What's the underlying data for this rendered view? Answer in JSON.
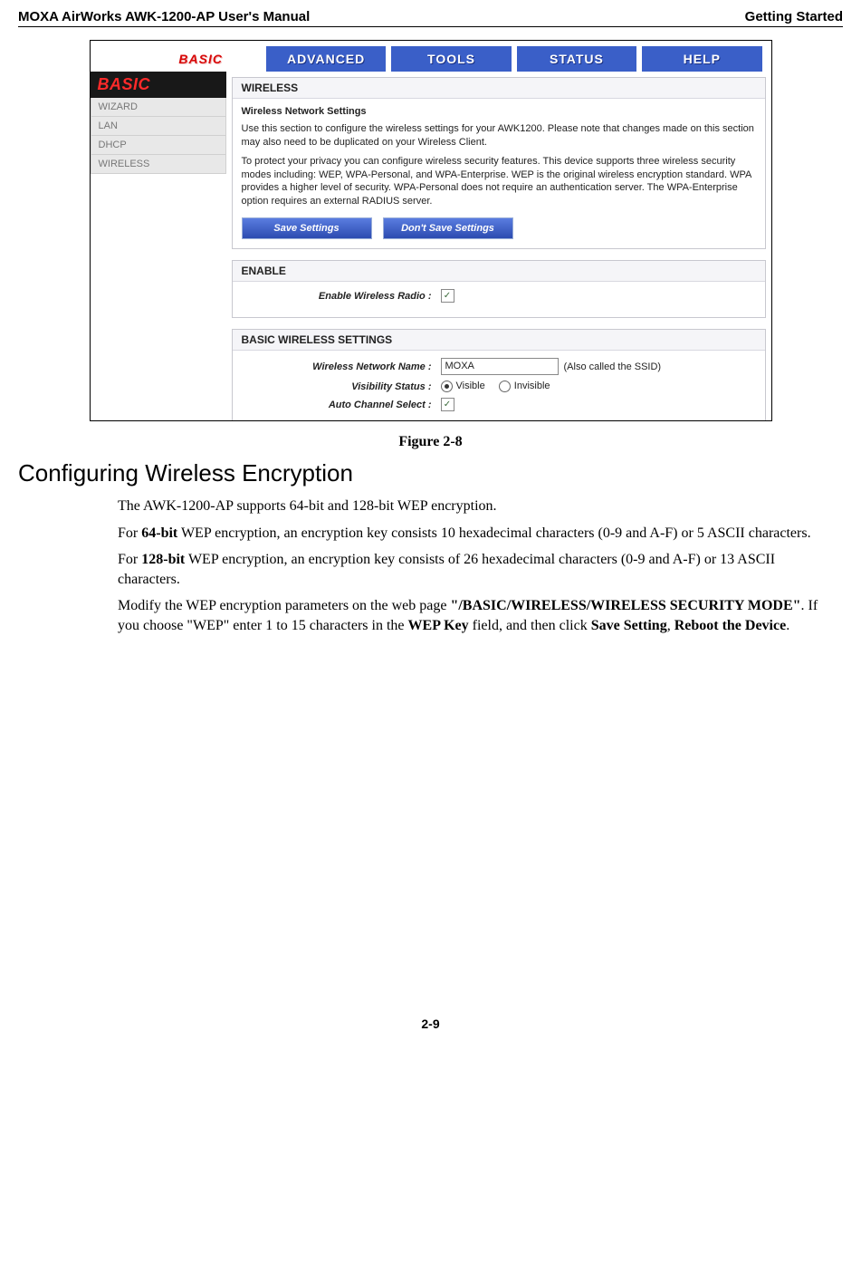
{
  "header": {
    "left": "MOXA AirWorks AWK-1200-AP User's Manual",
    "right": "Getting Started"
  },
  "tabs": {
    "items": [
      "BASIC",
      "ADVANCED",
      "TOOLS",
      "STATUS",
      "HELP"
    ],
    "active_index": 0
  },
  "sidebar": {
    "title": "BASIC",
    "items": [
      "WIZARD",
      "LAN",
      "DHCP",
      "WIRELESS"
    ]
  },
  "panels": {
    "wireless": {
      "title": "WIRELESS",
      "sub_title": "Wireless Network Settings",
      "p1": "Use this section to configure the wireless settings for your AWK1200. Please note that changes made on this section may also need to be duplicated on your Wireless Client.",
      "p2": "To protect your privacy you can configure wireless security features. This device supports three wireless security modes including: WEP, WPA-Personal, and WPA-Enterprise. WEP is the original wireless encryption standard. WPA provides a higher level of security. WPA-Personal does not require an authentication server. The WPA-Enterprise option requires an external RADIUS server.",
      "save_btn": "Save Settings",
      "dont_save_btn": "Don't Save Settings"
    },
    "enable": {
      "title": "ENABLE",
      "radio_label": "Enable Wireless Radio :",
      "checked": true
    },
    "basic_settings": {
      "title": "BASIC WIRELESS SETTINGS",
      "name_label": "Wireless Network Name :",
      "name_value": "MOXA",
      "name_note": "(Also called the SSID)",
      "visibility_label": "Visibility Status :",
      "visibility_options": [
        "Visible",
        "Invisible"
      ],
      "visibility_selected": "Visible",
      "auto_channel_label": "Auto Channel Select :",
      "auto_channel_checked": true
    }
  },
  "figure_caption": "Figure 2-8",
  "section_heading": "Configuring Wireless Encryption",
  "body": {
    "p1a": "The AWK-1200-AP supports 64-bit and 128-bit WEP encryption.",
    "p2_prefix": "For ",
    "p2_bold": "64-bit",
    "p2_rest": " WEP encryption, an encryption key consists 10 hexadecimal characters (0-9 and A-F) or 5 ASCII characters.",
    "p3_prefix": "For ",
    "p3_bold": "128-bit",
    "p3_rest": " WEP encryption, an encryption key consists of 26 hexadecimal characters (0-9 and A-F) or 13 ASCII characters.",
    "p4_a": "Modify the WEP encryption parameters on the web page ",
    "p4_b": "\"/BASIC/WIRELESS/WIRELESS SECURITY MODE\"",
    "p4_c": ". If you choose \"WEP\" enter 1 to 15 characters in the ",
    "p4_d": "WEP Key",
    "p4_e": " field, and then click ",
    "p4_f": "Save Setting",
    "p4_g": ", ",
    "p4_h": "Reboot the Device",
    "p4_i": "."
  },
  "page_number": "2-9"
}
